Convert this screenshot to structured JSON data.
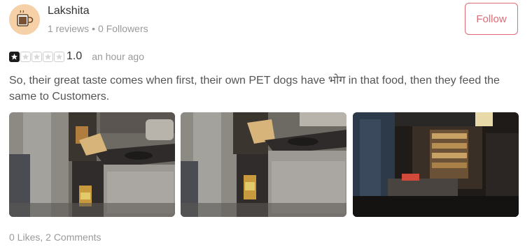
{
  "user": {
    "name": "Lakshita",
    "reviews": "1 reviews",
    "separator": "•",
    "followers": "0 Followers",
    "avatar_icon": "coffee-mug-icon",
    "avatar_bg": "#f6d1a8"
  },
  "follow_button": {
    "label": "Follow",
    "color": "#e06a75"
  },
  "rating": {
    "value": "1.0",
    "stars_filled": 1,
    "stars_total": 5,
    "time": "an hour ago"
  },
  "review": {
    "text": "So, their great taste comes when first, their own PET dogs have भोग in that food, then they feed the same to Customers."
  },
  "photos": [
    {
      "subject": "kitchen-stove-closeup"
    },
    {
      "subject": "kitchen-stove-closeup"
    },
    {
      "subject": "dark-shop-interior"
    }
  ],
  "footer": {
    "stats": "0 Likes, 2 Comments"
  }
}
